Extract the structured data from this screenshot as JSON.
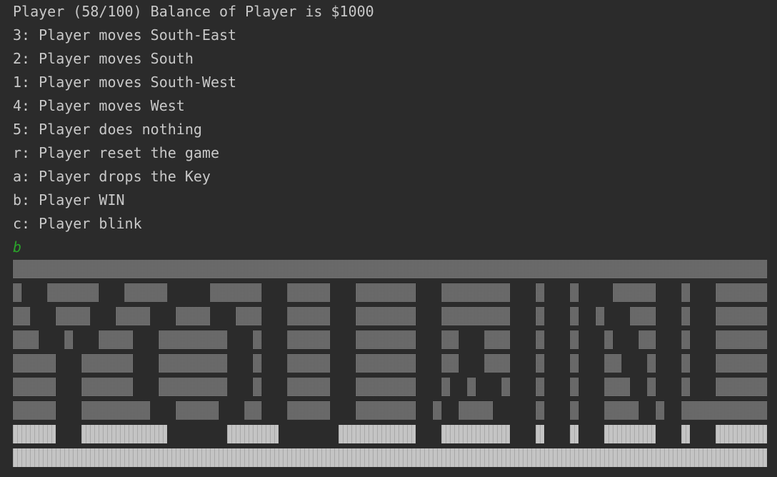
{
  "console": {
    "status_line": "Player (58/100) Balance of Player is $1000",
    "options": [
      "3: Player moves South-East",
      "2: Player moves South",
      "1: Player moves South-West",
      "4: Player moves West",
      "5: Player does nothing",
      "r: Player reset the game",
      "a: Player drops the Key",
      "b: Player WIN",
      "c: Player blink"
    ],
    "user_input": "b"
  },
  "colors": {
    "background": "#2b2b2b",
    "text": "#c8c8c8",
    "input": "#2aa52a",
    "block_shade": "#9a9a9a",
    "block_light": "#c4c4c4"
  }
}
